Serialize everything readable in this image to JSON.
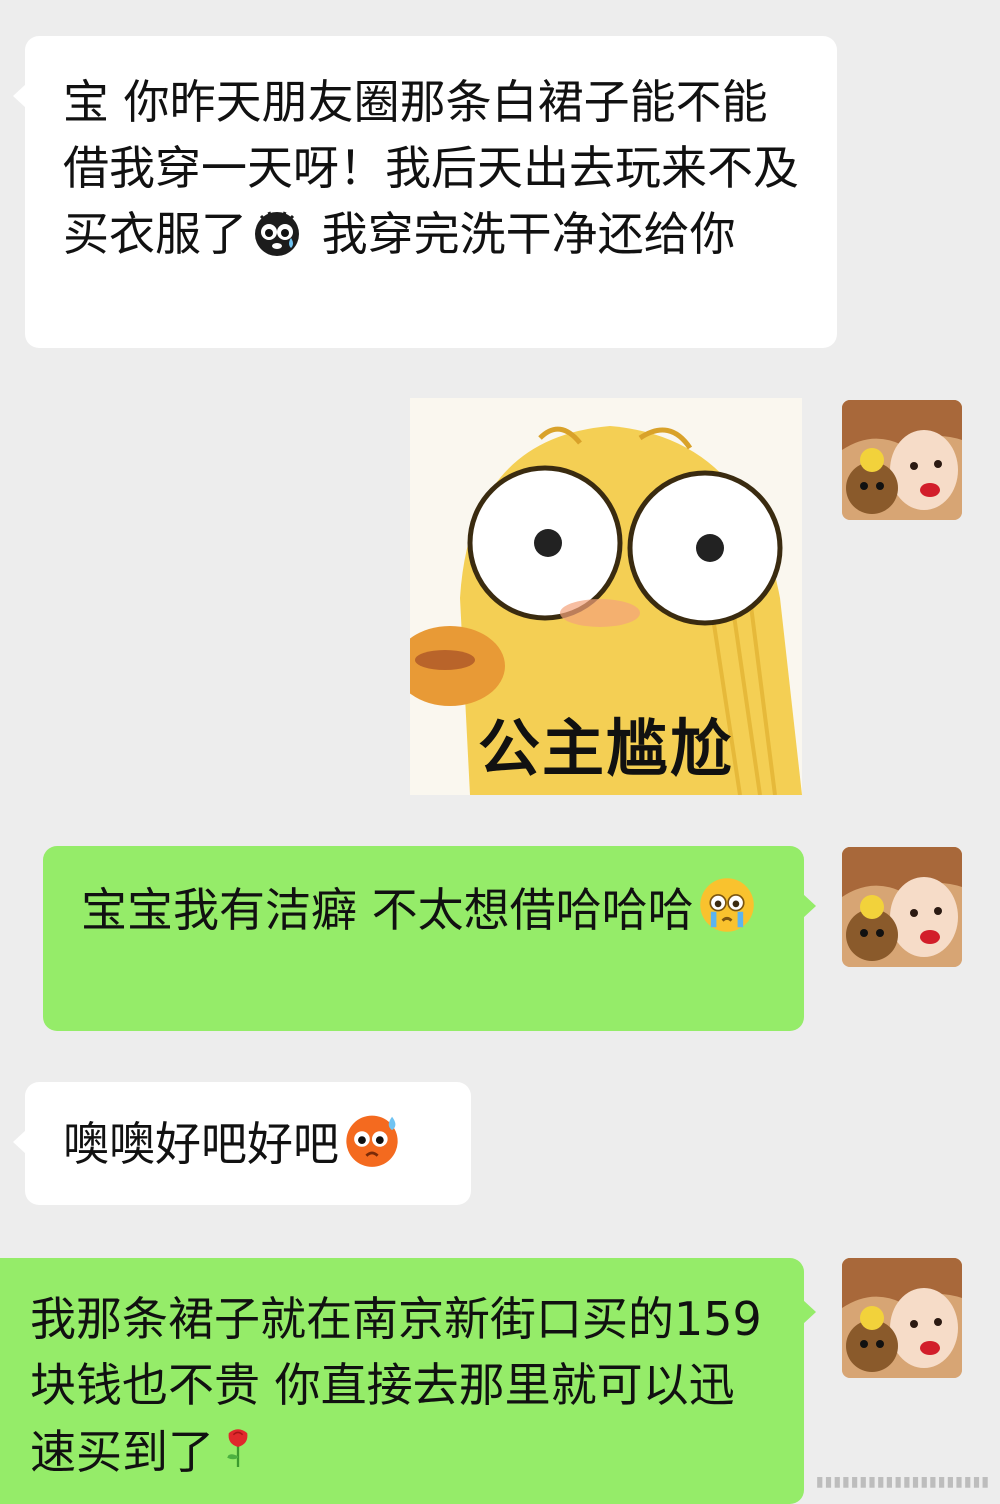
{
  "messages": [
    {
      "side": "left",
      "text_parts": [
        "宝 你昨天朋友圈那条白裙子能不能借我穿一天呀！我后天出去玩来不及买衣服了",
        " 我穿完洗干净还给你"
      ],
      "emoji": "crying-dark-face-emoji"
    },
    {
      "side": "right",
      "type": "sticker",
      "sticker_caption": "公主尴尬",
      "sticker_icon": "awkward-yellow-duck-sticker"
    },
    {
      "side": "right",
      "text": "宝宝我有洁癖 不太想借哈哈哈",
      "emoji": "tearful-face-emoji"
    },
    {
      "side": "left",
      "text": "噢噢好吧好吧",
      "emoji": "sweat-sad-face-emoji"
    },
    {
      "side": "right",
      "text": "我那条裙子就在南京新街口买的159块钱也不贵 你直接去那里就可以迅速买到了",
      "emoji": "rose-emoji"
    }
  ],
  "colors": {
    "background": "#ededed",
    "incoming_bubble": "#ffffff",
    "outgoing_bubble": "#95ec69"
  }
}
